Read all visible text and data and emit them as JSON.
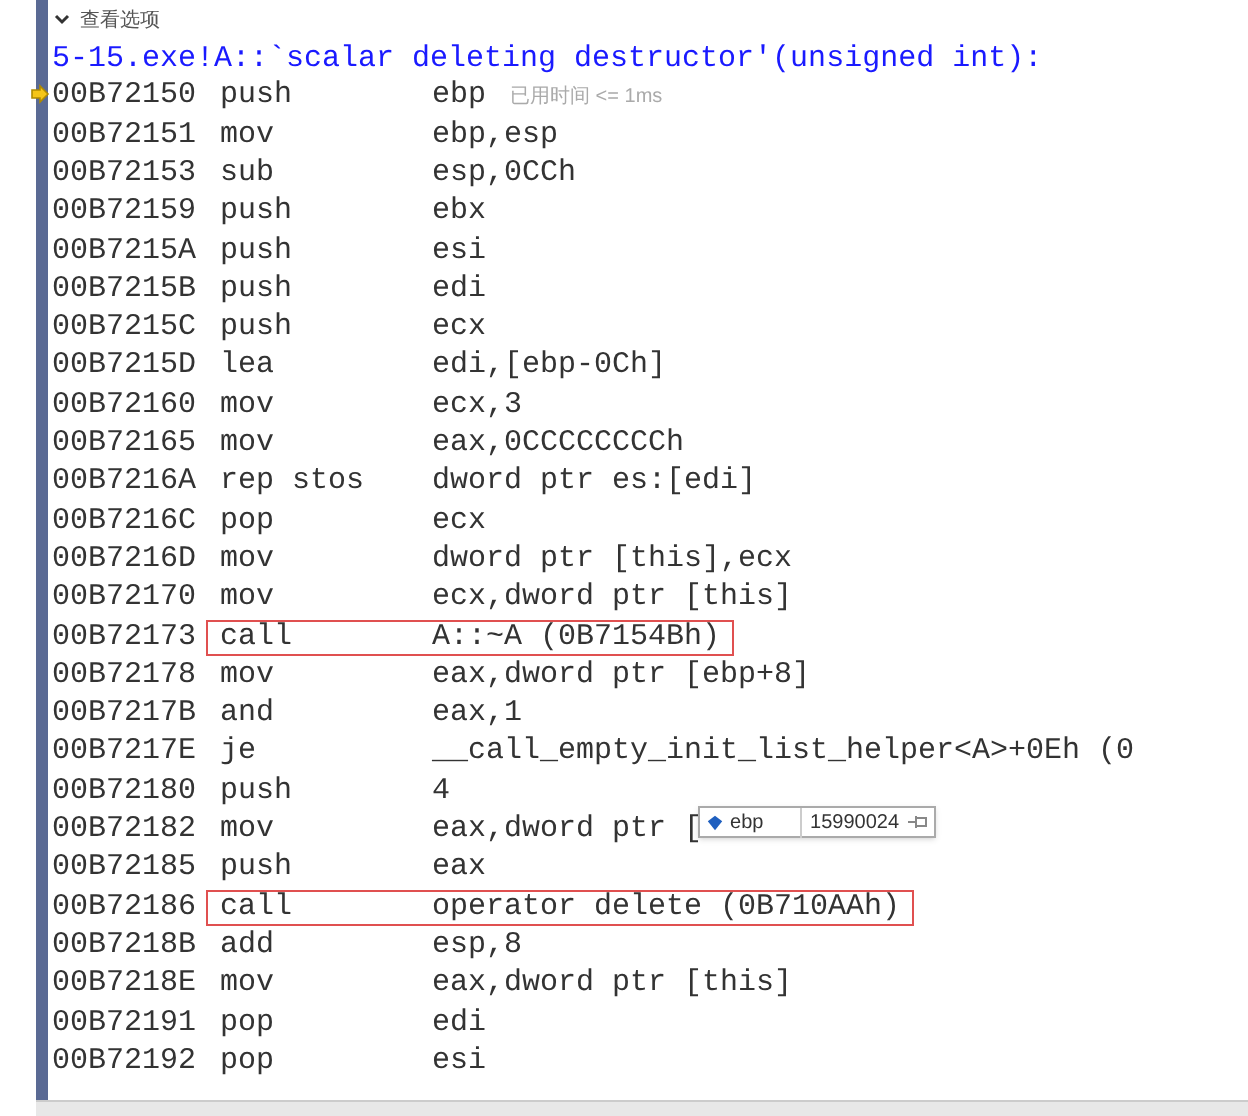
{
  "header": {
    "label": "查看选项",
    "expanded": true
  },
  "function_title": "5-15.exe!A::`scalar deleting destructor'(unsigned int):",
  "rows": [
    {
      "address": "00B72150",
      "mnemonic": "push",
      "operand": "ebp",
      "current": true,
      "boxed": false,
      "perf_tip": "已用时间 <= 1ms"
    },
    {
      "address": "00B72151",
      "mnemonic": "mov",
      "operand": "ebp,esp",
      "current": false,
      "boxed": false
    },
    {
      "address": "00B72153",
      "mnemonic": "sub",
      "operand": "esp,0CCh",
      "current": false,
      "boxed": false
    },
    {
      "address": "00B72159",
      "mnemonic": "push",
      "operand": "ebx",
      "current": false,
      "boxed": false
    },
    {
      "address": "00B7215A",
      "mnemonic": "push",
      "operand": "esi",
      "current": false,
      "boxed": false
    },
    {
      "address": "00B7215B",
      "mnemonic": "push",
      "operand": "edi",
      "current": false,
      "boxed": false
    },
    {
      "address": "00B7215C",
      "mnemonic": "push",
      "operand": "ecx",
      "current": false,
      "boxed": false
    },
    {
      "address": "00B7215D",
      "mnemonic": "lea",
      "operand": "edi,[ebp-0Ch]",
      "current": false,
      "boxed": false
    },
    {
      "address": "00B72160",
      "mnemonic": "mov",
      "operand": "ecx,3",
      "current": false,
      "boxed": false
    },
    {
      "address": "00B72165",
      "mnemonic": "mov",
      "operand": "eax,0CCCCCCCCh",
      "current": false,
      "boxed": false
    },
    {
      "address": "00B7216A",
      "mnemonic": "rep stos",
      "operand": "dword ptr es:[edi]",
      "current": false,
      "boxed": false
    },
    {
      "address": "00B7216C",
      "mnemonic": "pop",
      "operand": "ecx",
      "current": false,
      "boxed": false
    },
    {
      "address": "00B7216D",
      "mnemonic": "mov",
      "operand": "dword ptr [this],ecx",
      "current": false,
      "boxed": false
    },
    {
      "address": "00B72170",
      "mnemonic": "mov",
      "operand": "ecx,dword ptr [this]",
      "current": false,
      "boxed": false
    },
    {
      "address": "00B72173",
      "mnemonic": "call",
      "operand": "A::~A (0B7154Bh)",
      "current": false,
      "boxed": true
    },
    {
      "address": "00B72178",
      "mnemonic": "mov",
      "operand": "eax,dword ptr [ebp+8]",
      "current": false,
      "boxed": false
    },
    {
      "address": "00B7217B",
      "mnemonic": "and",
      "operand": "eax,1",
      "current": false,
      "boxed": false
    },
    {
      "address": "00B7217E",
      "mnemonic": "je",
      "operand": "__call_empty_init_list_helper<A>+0Eh (0",
      "current": false,
      "boxed": false
    },
    {
      "address": "00B72180",
      "mnemonic": "push",
      "operand": "4",
      "current": false,
      "boxed": false
    },
    {
      "address": "00B72182",
      "mnemonic": "mov",
      "operand": "eax,dword ptr [",
      "current": false,
      "boxed": false,
      "data_tip": {
        "name": "ebp",
        "value": "15990024"
      }
    },
    {
      "address": "00B72185",
      "mnemonic": "push",
      "operand": "eax",
      "current": false,
      "boxed": false
    },
    {
      "address": "00B72186",
      "mnemonic": "call",
      "operand": "operator delete (0B710AAh)",
      "current": false,
      "boxed": true
    },
    {
      "address": "00B7218B",
      "mnemonic": "add",
      "operand": "esp,8",
      "current": false,
      "boxed": false
    },
    {
      "address": "00B7218E",
      "mnemonic": "mov",
      "operand": "eax,dword ptr [this]",
      "current": false,
      "boxed": false
    },
    {
      "address": "00B72191",
      "mnemonic": "pop",
      "operand": "edi",
      "current": false,
      "boxed": false
    },
    {
      "address": "00B72192",
      "mnemonic": "pop",
      "operand": "esi",
      "current": false,
      "boxed": false
    }
  ]
}
